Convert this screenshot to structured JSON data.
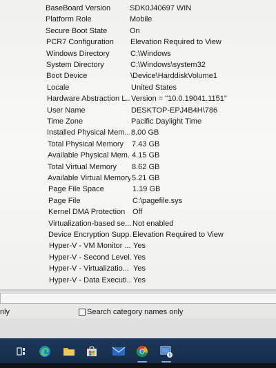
{
  "system_info": {
    "rows": [
      {
        "item": "BaseBoard Version",
        "value": "SDK0J40697 WIN"
      },
      {
        "item": "Platform Role",
        "value": "Mobile"
      },
      {
        "item": "Secure Boot State",
        "value": "On"
      },
      {
        "item": "PCR7 Configuration",
        "value": "Elevation Required to View"
      },
      {
        "item": "Windows Directory",
        "value": "C:\\Windows"
      },
      {
        "item": "System Directory",
        "value": "C:\\Windows\\system32"
      },
      {
        "item": "Boot Device",
        "value": "\\Device\\HarddiskVolume1"
      },
      {
        "item": "Locale",
        "value": "United States"
      },
      {
        "item": "Hardware Abstraction L...",
        "value": "Version = \"10.0.19041.1151\""
      },
      {
        "item": "User Name",
        "value": "DESKTOP-EPJ4B4H\\786"
      },
      {
        "item": "Time Zone",
        "value": "Pacific Daylight Time"
      },
      {
        "item": "Installed Physical Mem...",
        "value": "8.00 GB"
      },
      {
        "item": "Total Physical Memory",
        "value": "7.43 GB"
      },
      {
        "item": "Available Physical Mem...",
        "value": "4.15 GB"
      },
      {
        "item": "Total Virtual Memory",
        "value": "8.62 GB"
      },
      {
        "item": "Available Virtual Memory",
        "value": "5.21 GB"
      },
      {
        "item": "Page File Space",
        "value": "1.19 GB"
      },
      {
        "item": "Page File",
        "value": "C:\\pagefile.sys"
      },
      {
        "item": "Kernel DMA Protection",
        "value": "Off"
      },
      {
        "item": "Virtualization-based se...",
        "value": "Not enabled"
      },
      {
        "item": "Device Encryption Supp...",
        "value": "Elevation Required to View"
      },
      {
        "item": "Hyper-V - VM Monitor ...",
        "value": "Yes"
      },
      {
        "item": "Hyper-V - Second Level...",
        "value": "Yes"
      },
      {
        "item": "Hyper-V - Virtualizatio...",
        "value": "Yes"
      },
      {
        "item": "Hyper-V - Data Executi...",
        "value": "Yes"
      }
    ]
  },
  "find_bar": {
    "partial_option_label": "nly",
    "search_category_label": "Search category names only",
    "search_category_checked": false
  },
  "taskbar": {
    "icons": [
      {
        "name": "task-view-icon"
      },
      {
        "name": "edge-icon"
      },
      {
        "name": "file-explorer-icon"
      },
      {
        "name": "store-icon"
      },
      {
        "name": "mail-icon"
      },
      {
        "name": "chrome-icon"
      },
      {
        "name": "system-information-icon"
      }
    ],
    "colors": {
      "bar": "#1b3556",
      "accent": "#8fb7e8"
    }
  }
}
